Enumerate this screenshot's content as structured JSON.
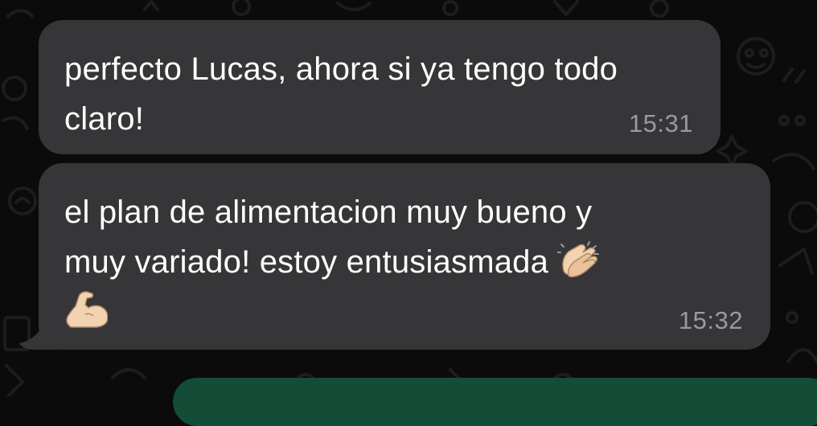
{
  "chat": {
    "messages": [
      {
        "direction": "incoming",
        "text": "perfecto Lucas, ahora si ya tengo todo claro!",
        "time": "15:31"
      },
      {
        "direction": "incoming",
        "text_line1": "el plan de alimentacion muy bueno y",
        "text_line2": "muy variado! estoy entusiasmada",
        "emojis": [
          "clapping-hands-emoji",
          "flexed-biceps-emoji"
        ],
        "time": "15:32"
      }
    ]
  },
  "colors": {
    "background": "#0b0b0b",
    "incoming_bubble": "#363638",
    "timestamp": "#9a9a9e",
    "outgoing_bubble": "#134d37"
  }
}
